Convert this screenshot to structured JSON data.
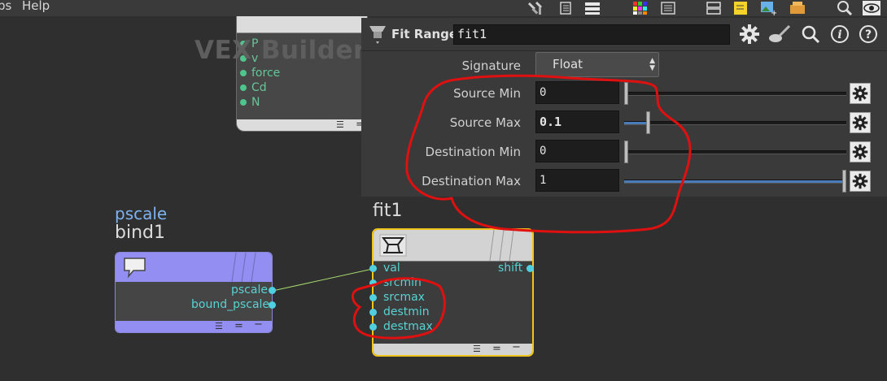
{
  "menu": {
    "items": [
      "ps",
      "Help"
    ]
  },
  "vex_builder": {
    "title": "VEX Builder",
    "ports": [
      "P",
      "v",
      "force",
      "Cd",
      "N"
    ]
  },
  "param_panel": {
    "node_type": "Fit Range",
    "node_name": "fit1",
    "signature": {
      "label": "Signature",
      "value": "Float"
    },
    "params": [
      {
        "label": "Source Min",
        "value": "0",
        "slider_fraction": 0.0
      },
      {
        "label": "Source Max",
        "value": "0.1",
        "slider_fraction": 0.1
      },
      {
        "label": "Destination Min",
        "value": "0",
        "slider_fraction": 0.0
      },
      {
        "label": "Destination Max",
        "value": "1",
        "slider_fraction": 1.0
      }
    ]
  },
  "bind_node": {
    "parm_name": "pscale",
    "name": "bind1",
    "outputs": [
      "pscale",
      "bound_pscale"
    ]
  },
  "fit_node": {
    "name": "fit1",
    "inputs": [
      "val",
      "srcmin",
      "srcmax",
      "destmin",
      "destmax"
    ],
    "outputs": [
      "shift"
    ]
  },
  "colors": {
    "background": "#2f2f2f",
    "bind_node": "#928ef2",
    "fit_node_border": "#f0c419",
    "port": "#4fd0e0",
    "annotation": "#e01010"
  }
}
